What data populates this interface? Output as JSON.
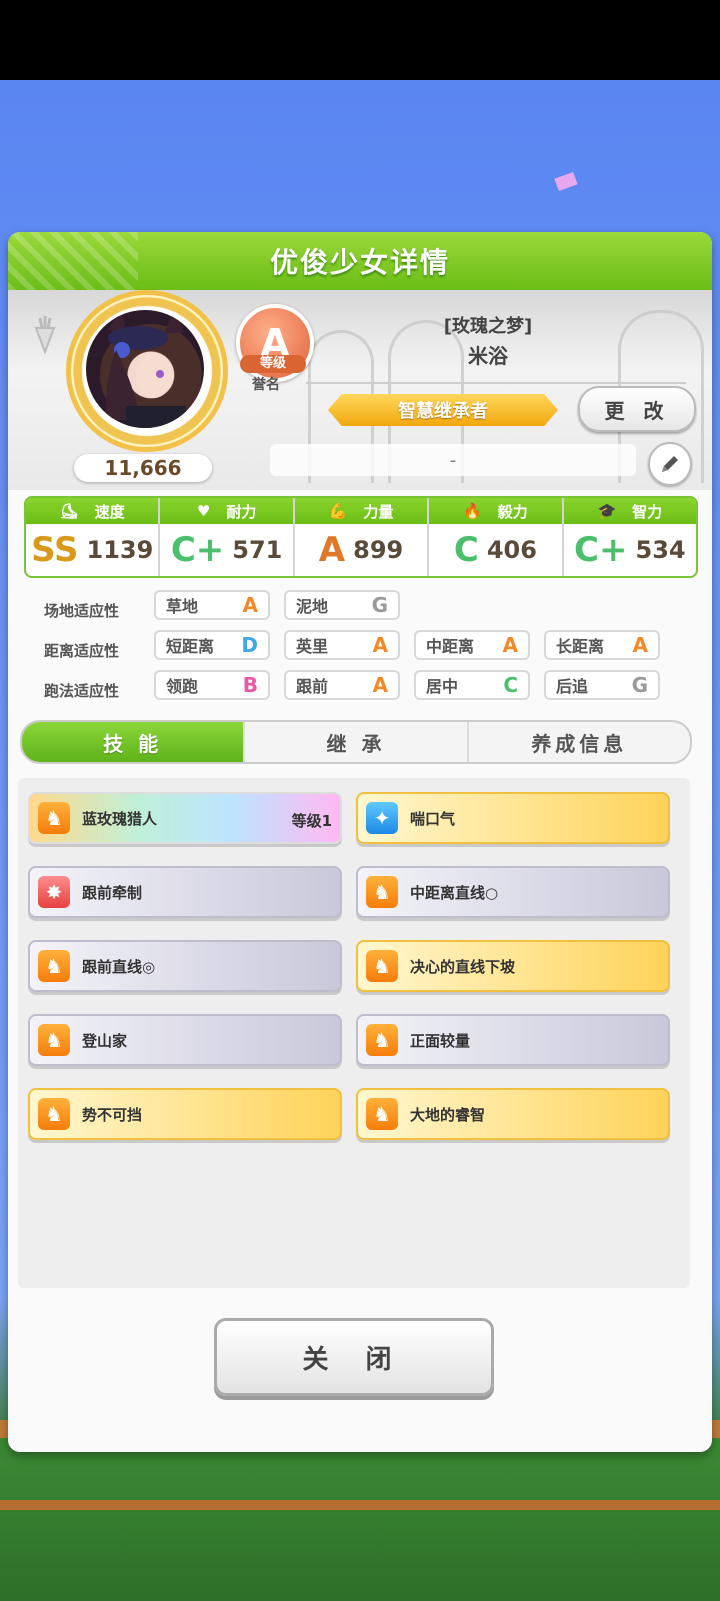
{
  "dialog": {
    "title": "优俊少女详情"
  },
  "profile": {
    "fan_count": "11,666",
    "rank": "A",
    "rank_label": "等级",
    "rank_sub": "誉名",
    "uma_title": "[玫瑰之梦]",
    "uma_name": "米浴",
    "title_ribbon": "智慧继承者",
    "change_label": "更 改",
    "memo": "-"
  },
  "stats": [
    {
      "label": "速度",
      "icon": "shoe-icon",
      "grade": "SS",
      "grade_color": "#d99a1c",
      "value": "1139"
    },
    {
      "label": "耐力",
      "icon": "heart-icon",
      "grade": "C+",
      "grade_color": "#4bbf6b",
      "value": "571"
    },
    {
      "label": "力量",
      "icon": "muscle-icon",
      "grade": "A",
      "grade_color": "#e0782a",
      "value": "899"
    },
    {
      "label": "毅力",
      "icon": "flame-icon",
      "grade": "C",
      "grade_color": "#4bbf6b",
      "value": "406"
    },
    {
      "label": "智力",
      "icon": "graduation-cap-icon",
      "grade": "C+",
      "grade_color": "#4bbf6b",
      "value": "534"
    }
  ],
  "aptitudes": {
    "track_label": "场地适应性",
    "distance_label": "距离适应性",
    "style_label": "跑法适应性",
    "track": [
      {
        "name": "草地",
        "grade": "A",
        "color": "#f08a2a"
      },
      {
        "name": "泥地",
        "grade": "G",
        "color": "#999999"
      }
    ],
    "distance": [
      {
        "name": "短距离",
        "grade": "D",
        "color": "#3fa8e6"
      },
      {
        "name": "英里",
        "grade": "A",
        "color": "#f08a2a"
      },
      {
        "name": "中距离",
        "grade": "A",
        "color": "#f08a2a"
      },
      {
        "name": "长距离",
        "grade": "A",
        "color": "#f08a2a"
      }
    ],
    "style": [
      {
        "name": "领跑",
        "grade": "B",
        "color": "#e85aa8"
      },
      {
        "name": "跟前",
        "grade": "A",
        "color": "#f08a2a"
      },
      {
        "name": "居中",
        "grade": "C",
        "color": "#4bbf6b"
      },
      {
        "name": "后追",
        "grade": "G",
        "color": "#999999"
      }
    ]
  },
  "tabs": {
    "skills": "技 能",
    "inherit": "继 承",
    "training_info": "养成信息"
  },
  "skills": [
    {
      "name": "蓝玫瑰猎人",
      "level": "等级1"
    },
    {
      "name": "喘口气"
    },
    {
      "name": "跟前牵制"
    },
    {
      "name": "中距离直线○"
    },
    {
      "name": "跟前直线◎"
    },
    {
      "name": "决心的直线下坡"
    },
    {
      "name": "登山家"
    },
    {
      "name": "正面较量"
    },
    {
      "name": "势不可挡"
    },
    {
      "name": "大地的睿智"
    }
  ],
  "close_label": "关 闭"
}
